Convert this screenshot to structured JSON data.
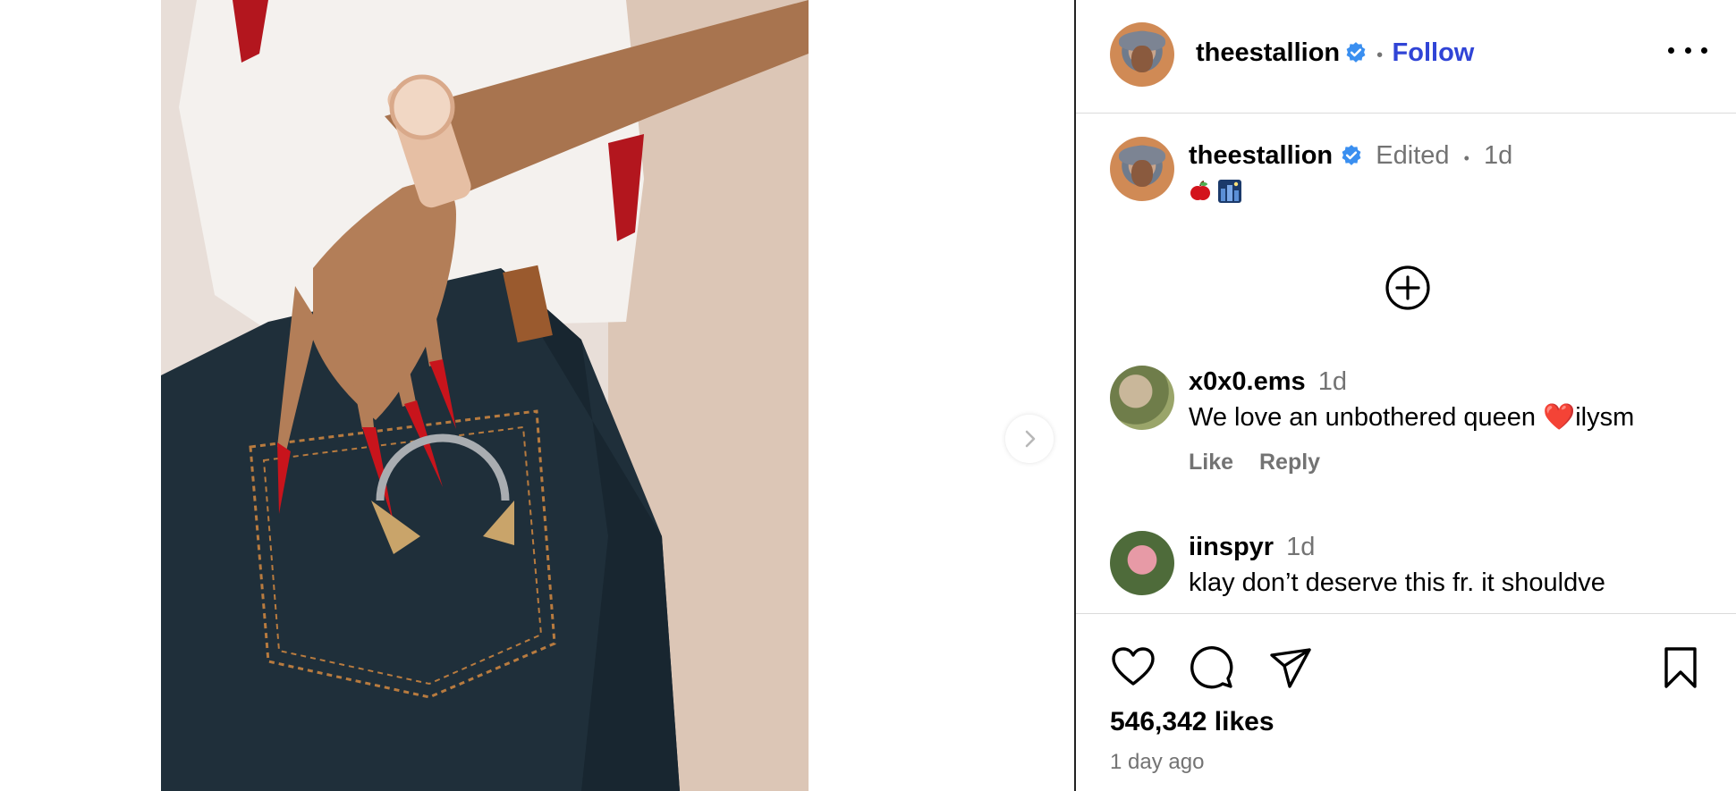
{
  "post": {
    "username": "theestallion",
    "follow_label": "Follow",
    "header_separator": "•",
    "edited_label": "Edited",
    "caption_separator": "•",
    "caption_time": "1d",
    "caption_emoji": [
      "red-apple",
      "night-city"
    ]
  },
  "comments": [
    {
      "username": "x0x0.ems",
      "time": "1d",
      "text": "We love an unbothered queen ❤️ilysm",
      "like_label": "Like",
      "reply_label": "Reply"
    },
    {
      "username": "iinspyr",
      "time": "1d",
      "text": "klay don’t deserve this fr. it shouldve"
    }
  ],
  "footer": {
    "likes": "546,342 likes",
    "posted": "1 day ago"
  },
  "icons": {
    "verified": "verified-badge-icon",
    "more": "more-options-icon",
    "load_more": "add-circle-icon",
    "next": "chevron-right-icon",
    "like": "heart-icon",
    "comment": "comment-icon",
    "share": "send-icon",
    "save": "bookmark-icon"
  },
  "colors": {
    "accent": "#3044d6",
    "verified": "#3a8ff0",
    "muted": "#737373"
  }
}
